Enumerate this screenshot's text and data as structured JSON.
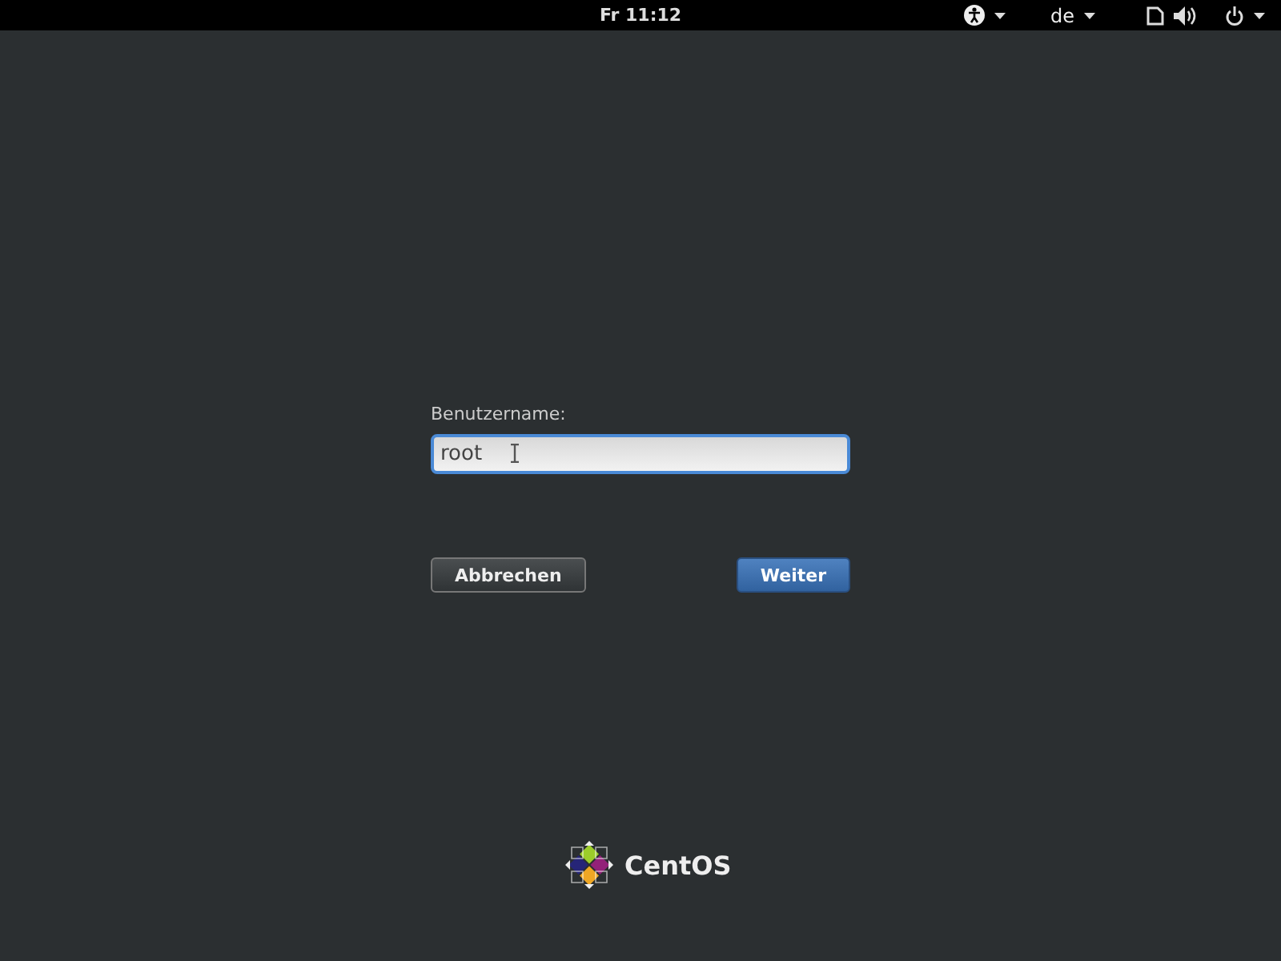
{
  "top_bar": {
    "clock": "Fr 11:12",
    "keyboard_layout": "de"
  },
  "login": {
    "label": "Benutzername:",
    "username": {
      "value": "root"
    },
    "buttons": [
      {
        "label": "Abbrechen",
        "kind": "secondary"
      },
      {
        "label": "Weiter",
        "kind": "primary"
      }
    ]
  },
  "logo": {
    "text": "CentOS"
  }
}
